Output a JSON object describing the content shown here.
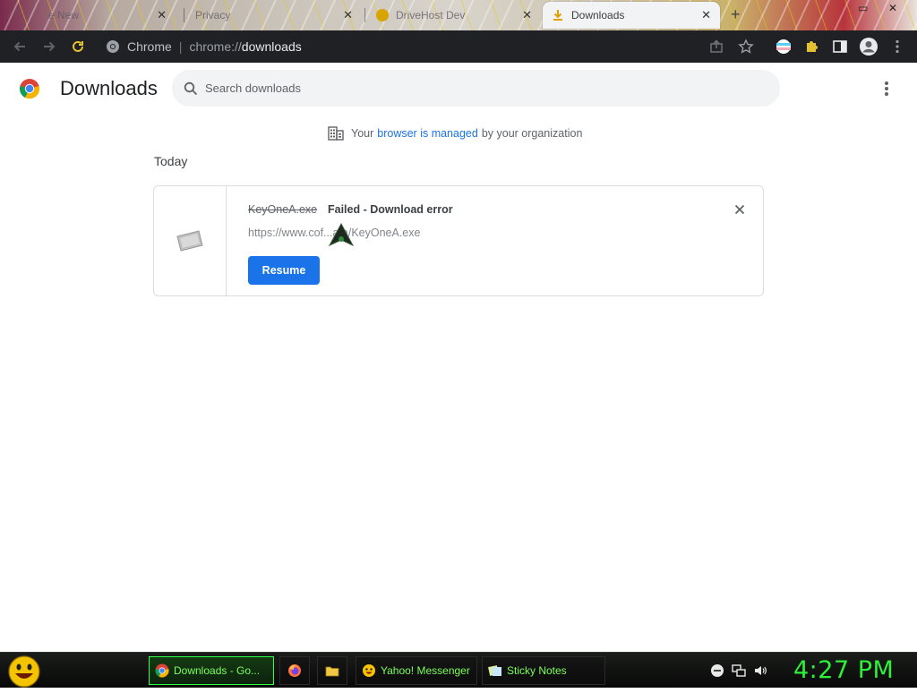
{
  "tabs": [
    {
      "title": "e New",
      "active": false
    },
    {
      "title": "Privacy",
      "active": false
    },
    {
      "title": "DriveHost Dev",
      "active": false
    },
    {
      "title": "Downloads",
      "active": true
    }
  ],
  "omnibox": {
    "site": "Chrome",
    "scheme": "chrome://",
    "path": "downloads"
  },
  "page": {
    "title": "Downloads"
  },
  "search": {
    "placeholder": "Search downloads"
  },
  "managed": {
    "prefix": "Your",
    "link": "browser is managed",
    "suffix": "by your organization"
  },
  "day_label": "Today",
  "download": {
    "file_name": "KeyOneA.exe",
    "status": "Failed - Download error",
    "url": "https://www.cof...a/a/KeyOneA.exe",
    "resume_label": "Resume"
  },
  "taskbar": {
    "items": [
      {
        "label": "Downloads - Go...",
        "icon": "chrome-icon",
        "active": true
      },
      {
        "label": "",
        "icon": "firefox-icon",
        "active": false
      },
      {
        "label": "",
        "icon": "folder-icon",
        "active": false
      },
      {
        "label": "Yahoo! Messenger",
        "icon": "yahoo-messenger-icon",
        "active": false
      },
      {
        "label": "Sticky Notes",
        "icon": "sticky-notes-icon",
        "active": false
      }
    ],
    "clock": "4:27 PM"
  },
  "colors": {
    "accent": "#1a73e8",
    "taskbar_text": "#7cff5a",
    "clock": "#2ef03a"
  }
}
